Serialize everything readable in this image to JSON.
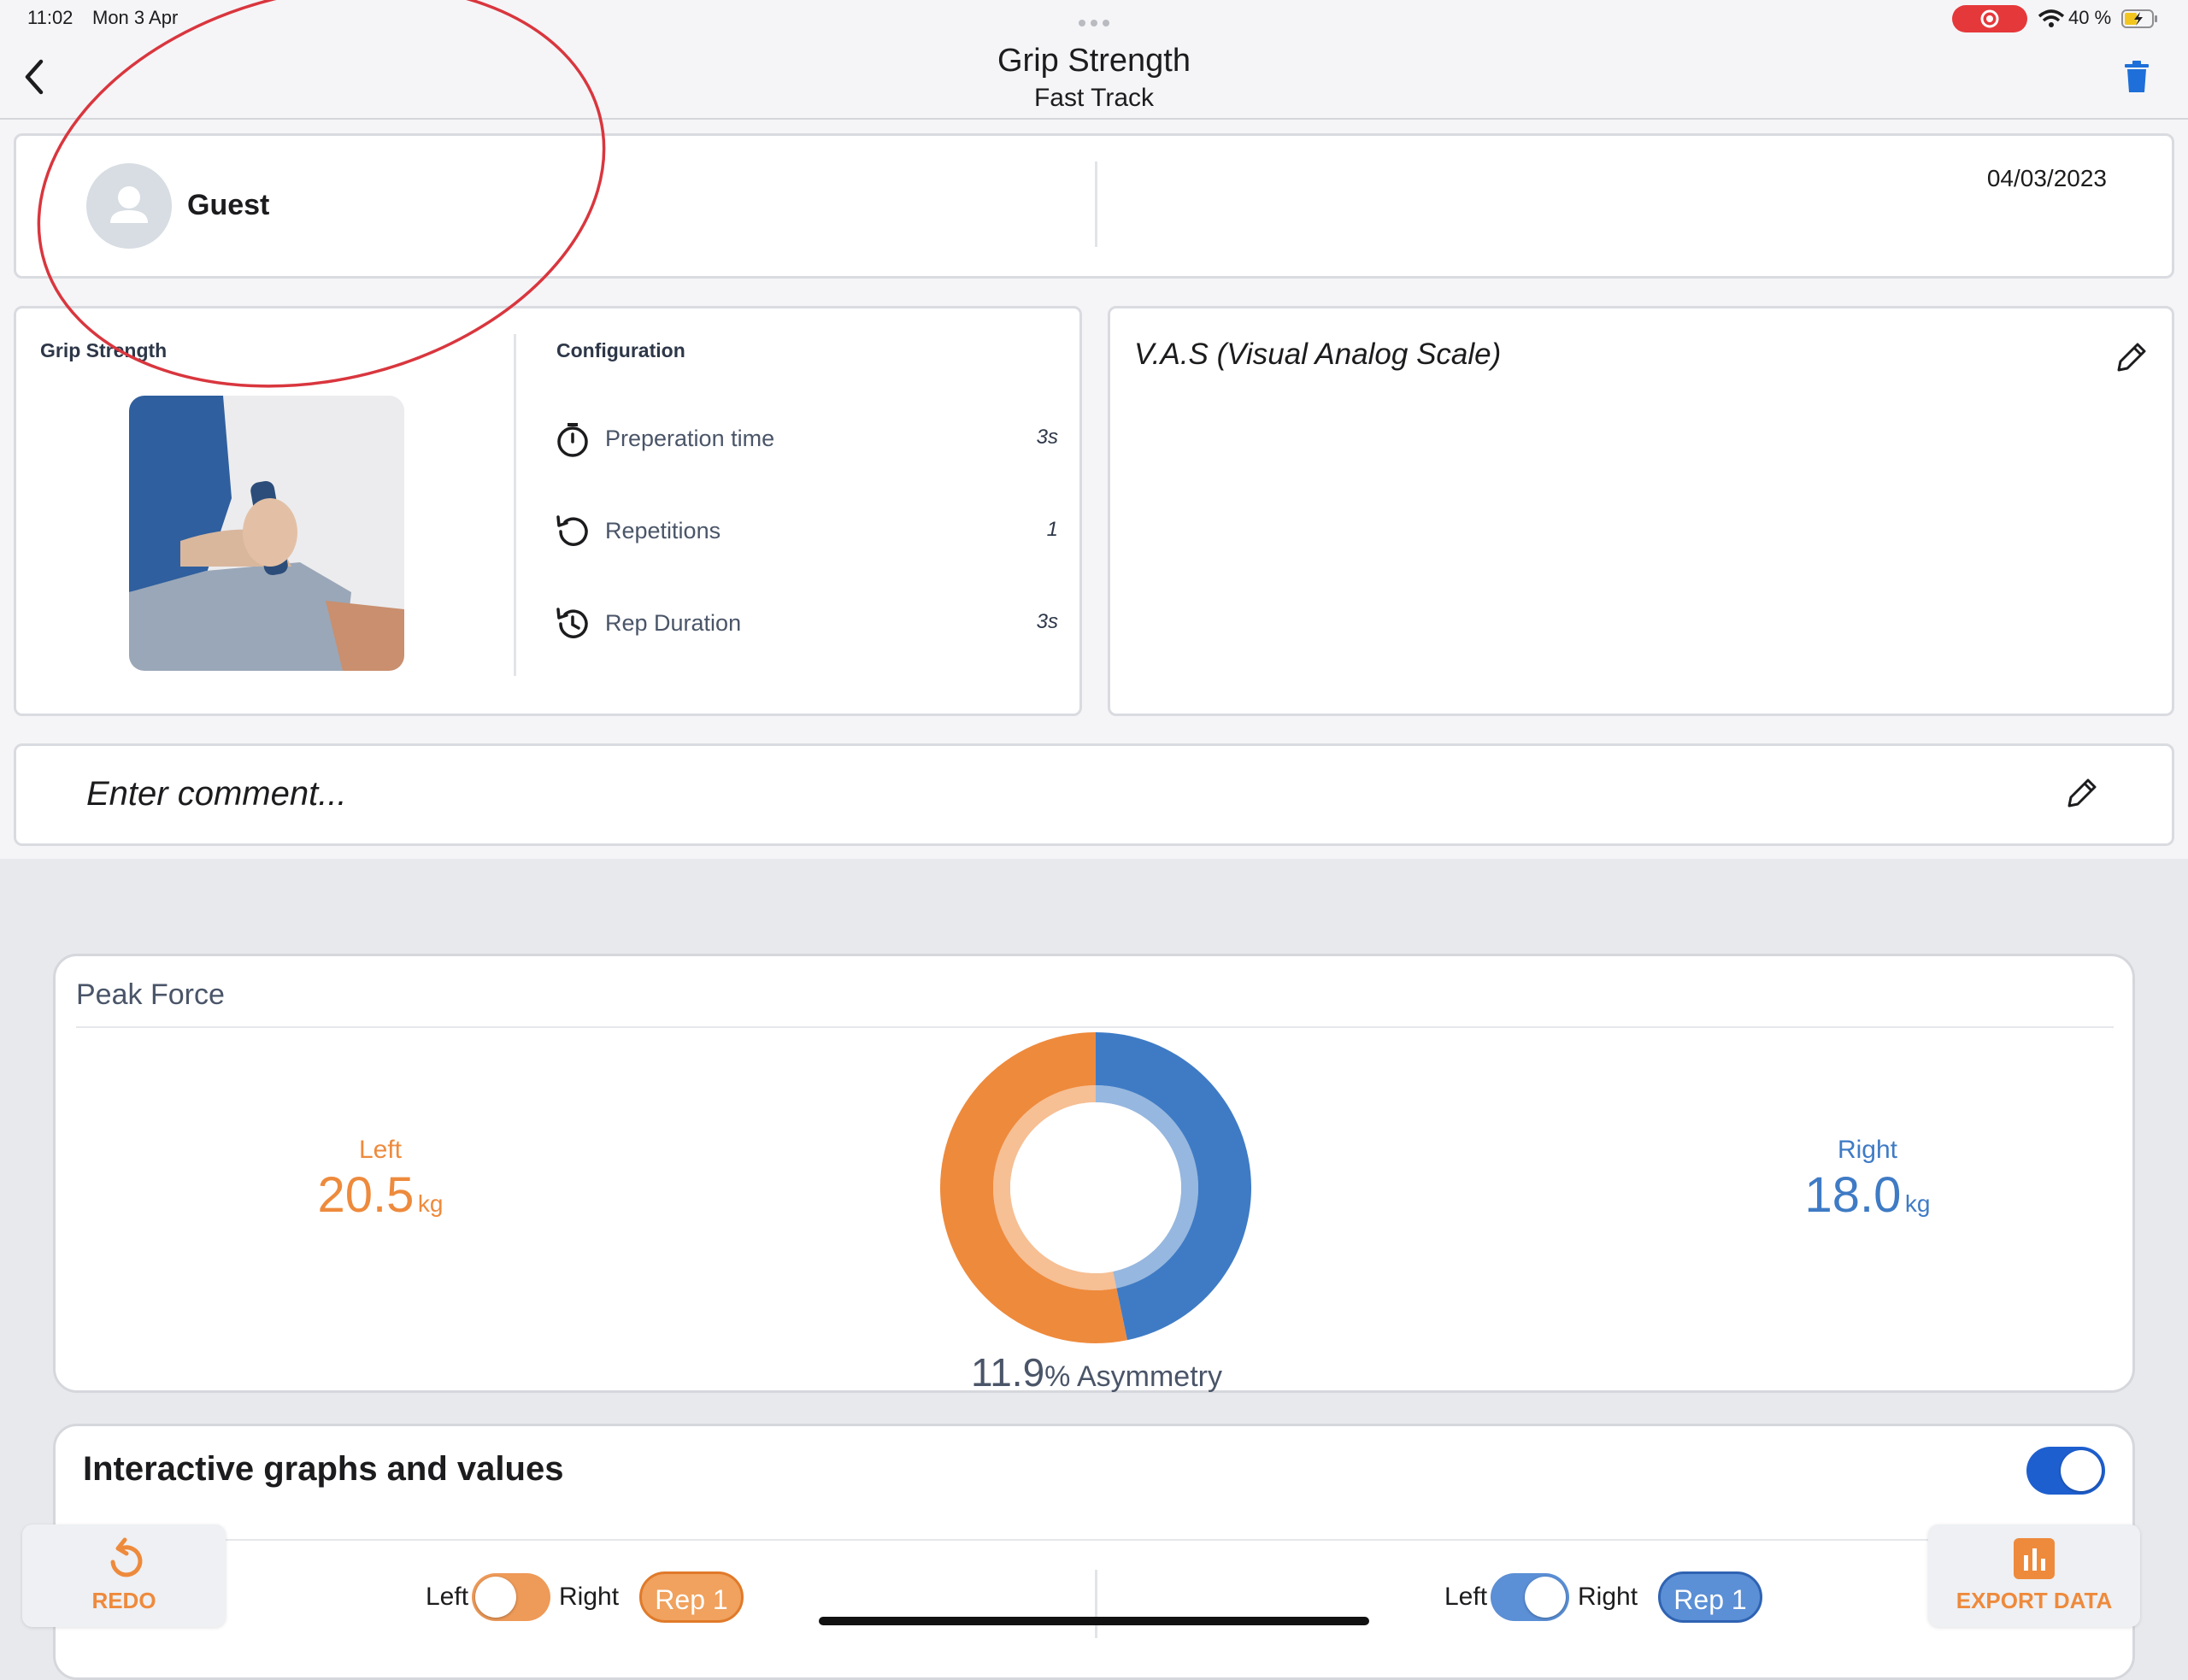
{
  "status_bar": {
    "time": "11:02",
    "date": "Mon 3 Apr",
    "battery": "40 %"
  },
  "header": {
    "title": "Grip Strength",
    "subtitle": "Fast Track"
  },
  "patient": {
    "name": "Guest",
    "date": "04/03/2023"
  },
  "exercise": {
    "title": "Grip Strength",
    "config_title": "Configuration",
    "config": [
      {
        "label": "Preperation time",
        "value": "3s",
        "icon": "stopwatch-icon"
      },
      {
        "label": "Repetitions",
        "value": "1",
        "icon": "repeat-icon"
      },
      {
        "label": "Rep Duration",
        "value": "3s",
        "icon": "history-icon"
      }
    ]
  },
  "vas": {
    "title": "V.A.S (Visual Analog Scale)"
  },
  "comment": {
    "placeholder": "Enter comment..."
  },
  "peak_force": {
    "title": "Peak Force",
    "left_label": "Left",
    "left_value": "20.5",
    "left_unit": "kg",
    "right_label": "Right",
    "right_value": "18.0",
    "right_unit": "kg",
    "asymmetry_value": "11.9",
    "asymmetry_label": "% Asymmetry"
  },
  "chart_data": {
    "type": "pie",
    "series": [
      {
        "name": "Left",
        "value": 20.5,
        "color": "#ee8a3c"
      },
      {
        "name": "Right",
        "value": 18.0,
        "color": "#3f7bc5"
      }
    ]
  },
  "interactive": {
    "title": "Interactive graphs and values",
    "toggle_on": true,
    "left_panel": {
      "left": "Left",
      "right": "Right",
      "rep": "Rep 1"
    },
    "right_panel": {
      "left": "Left",
      "right": "Right",
      "rep": "Rep 1"
    }
  },
  "bottom": {
    "redo": "REDO",
    "export": "EXPORT DATA"
  },
  "colors": {
    "orange": "#ee8a3c",
    "blue": "#3f7bc5",
    "annotation": "#d9363e",
    "toggle_blue": "#1e5fd0"
  }
}
